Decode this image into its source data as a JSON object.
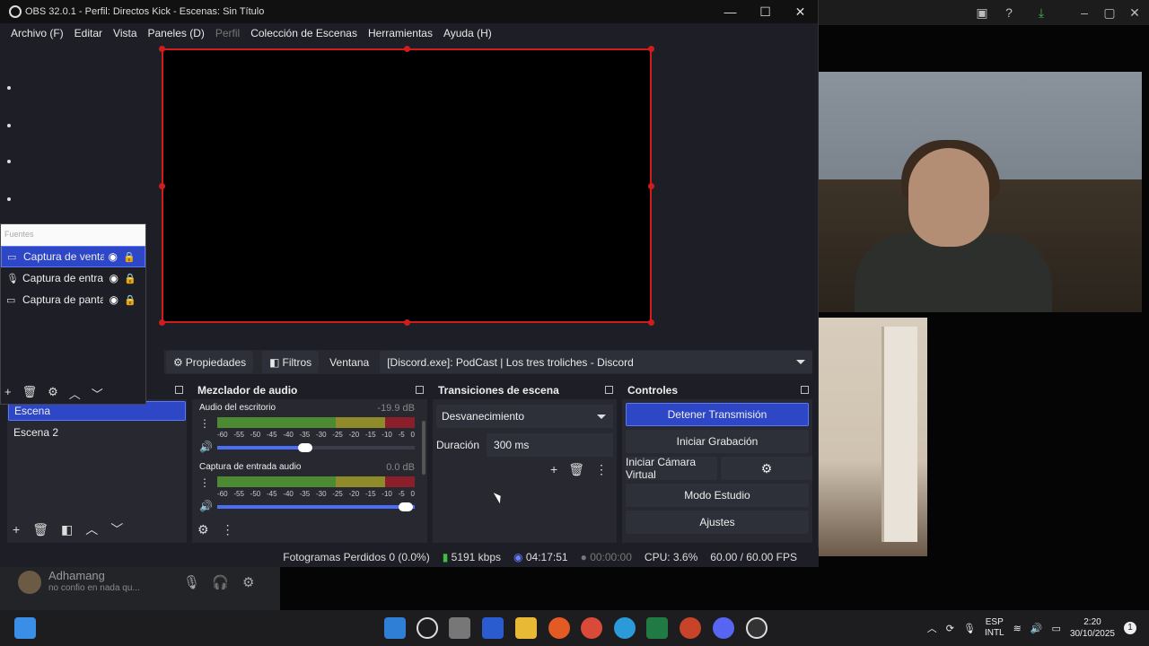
{
  "window": {
    "title": "OBS 32.0.1 - Perfil: Directos Kick - Escenas: Sin Título",
    "minimize": "—",
    "maximize": "☐",
    "close": "✕"
  },
  "menu": {
    "items": [
      "Archivo (F)",
      "Editar",
      "Vista",
      "Paneles (D)",
      "Perfil",
      "Colección de Escenas",
      "Herramientas",
      "Ayuda (H)"
    ]
  },
  "source_toolbar": {
    "properties": "Propiedades",
    "filters": "Filtros",
    "window_label": "Ventana",
    "window_value": "[Discord.exe]: PodCast | Los tres troliches - Discord"
  },
  "sources": {
    "title": "Fuentes",
    "items": [
      {
        "name": "Captura de ventana"
      },
      {
        "name": "Captura de entrada"
      },
      {
        "name": "Captura de pantalla"
      }
    ]
  },
  "scenes": {
    "items": [
      "Escena",
      "Escena 2"
    ]
  },
  "mixer": {
    "title": "Mezclador de audio",
    "channels": [
      {
        "name": "Audio del escritorio",
        "db": "-19.9 dB",
        "volume": 0.44
      },
      {
        "name": "Captura de entrada audio",
        "db": "0.0 dB",
        "volume": 1.0
      }
    ],
    "scale": [
      "-60",
      "-55",
      "-50",
      "-45",
      "-40",
      "-35",
      "-30",
      "-25",
      "-20",
      "-15",
      "-10",
      "-5",
      "0"
    ]
  },
  "transitions": {
    "title": "Transiciones de escena",
    "selected": "Desvanecimiento",
    "duration_label": "Duración",
    "duration_value": "300 ms"
  },
  "controls": {
    "title": "Controles",
    "stop_stream": "Detener Transmisión",
    "start_recording": "Iniciar Grabación",
    "start_virtual_cam": "Iniciar Cámara Virtual",
    "studio_mode": "Modo Estudio",
    "settings": "Ajustes"
  },
  "status": {
    "dropped": "Fotogramas Perdidos 0 (0.0%)",
    "bitrate": "5191 kbps",
    "stream_time": "04:17:51",
    "rec_time": "00:00:00",
    "cpu": "CPU: 3.6%",
    "fps": "60.00 / 60.00 FPS"
  },
  "discord": {
    "username": "Adhamang",
    "status_text": "no confio en nada qu..."
  },
  "tray": {
    "lang_top": "ESP",
    "lang_bottom": "INTL",
    "time": "2:20",
    "date": "30/10/2025",
    "notifications": "1"
  },
  "colors": {
    "accent": "#2d47c7",
    "preview_border": "#d01c1c"
  }
}
